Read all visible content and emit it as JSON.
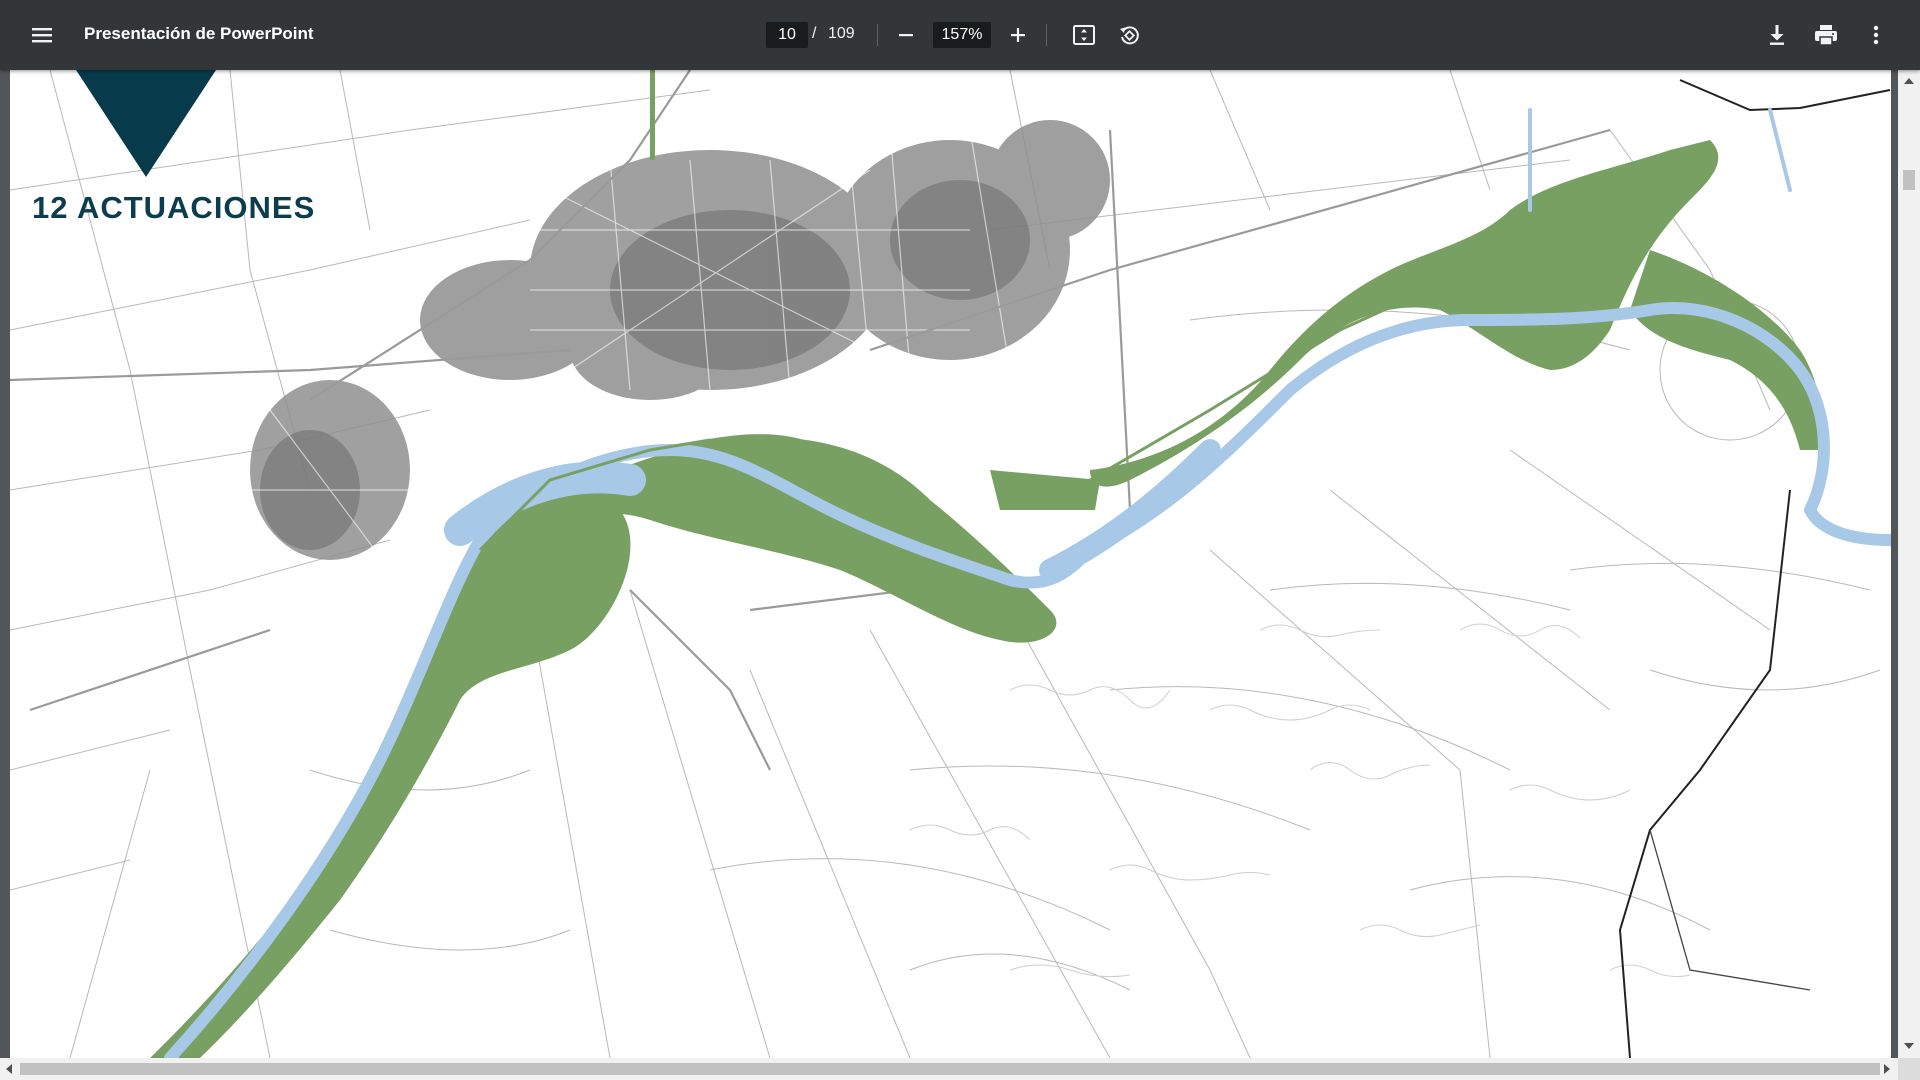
{
  "toolbar": {
    "title": "Presentación de PowerPoint",
    "page_current": "10",
    "page_separator": "/",
    "page_total": "109",
    "zoom": "157%"
  },
  "icons": {
    "menu": "menu-icon",
    "zoom_out": "minus-icon",
    "zoom_in": "plus-icon",
    "fit": "fit-to-page-icon",
    "rotate": "rotate-counterclockwise-icon",
    "download": "download-icon",
    "print": "print-icon",
    "more": "more-vertical-icon"
  },
  "slide": {
    "title": "12 ACTUACIONES",
    "colors": {
      "title": "#0b3d4e",
      "triangle": "#073b4c",
      "green_areas": "#78a063",
      "river": "#a8c8e8",
      "streets": "#777777"
    }
  },
  "scroll": {
    "vertical_position": 0.1,
    "horizontal_position": 0.0
  }
}
